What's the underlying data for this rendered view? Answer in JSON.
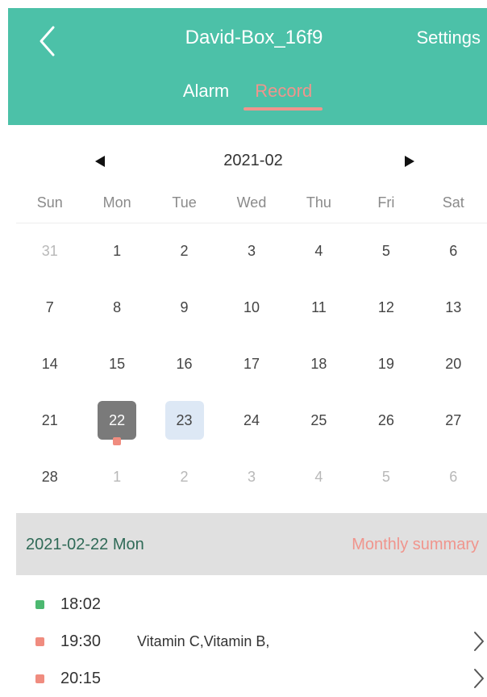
{
  "header": {
    "title": "David-Box_16f9",
    "settings_label": "Settings",
    "back_icon": "chevron-left-icon",
    "tabs": [
      {
        "label": "Alarm",
        "active": false
      },
      {
        "label": "Record",
        "active": true
      }
    ]
  },
  "calendar": {
    "month_label": "2021-02",
    "weekdays": [
      "Sun",
      "Mon",
      "Tue",
      "Wed",
      "Thu",
      "Fri",
      "Sat"
    ],
    "days": [
      {
        "num": "31",
        "other": true
      },
      {
        "num": "1"
      },
      {
        "num": "2"
      },
      {
        "num": "3"
      },
      {
        "num": "4"
      },
      {
        "num": "5"
      },
      {
        "num": "6"
      },
      {
        "num": "7"
      },
      {
        "num": "8"
      },
      {
        "num": "9"
      },
      {
        "num": "10"
      },
      {
        "num": "11"
      },
      {
        "num": "12"
      },
      {
        "num": "13"
      },
      {
        "num": "14"
      },
      {
        "num": "15"
      },
      {
        "num": "16"
      },
      {
        "num": "17"
      },
      {
        "num": "18"
      },
      {
        "num": "19"
      },
      {
        "num": "20"
      },
      {
        "num": "21"
      },
      {
        "num": "22",
        "selected": true,
        "dot": true
      },
      {
        "num": "23",
        "today": true
      },
      {
        "num": "24"
      },
      {
        "num": "25"
      },
      {
        "num": "26"
      },
      {
        "num": "27"
      },
      {
        "num": "28"
      },
      {
        "num": "1",
        "other": true
      },
      {
        "num": "2",
        "other": true
      },
      {
        "num": "3",
        "other": true
      },
      {
        "num": "4",
        "other": true
      },
      {
        "num": "5",
        "other": true
      },
      {
        "num": "6",
        "other": true
      }
    ]
  },
  "summary": {
    "date_label": "2021-02-22   Mon",
    "monthly_label": "Monthly summary"
  },
  "records": [
    {
      "time": "18:02",
      "text": "",
      "color": "#4cb870",
      "has_arrow": false
    },
    {
      "time": "19:30",
      "text": "Vitamin C,Vitamin B,",
      "color": "#f08c7f",
      "has_arrow": true
    },
    {
      "time": "20:15",
      "text": "",
      "color": "#f08c7f",
      "has_arrow": true
    }
  ],
  "colors": {
    "brand": "#4cc1a8",
    "accent": "#f0958d"
  }
}
